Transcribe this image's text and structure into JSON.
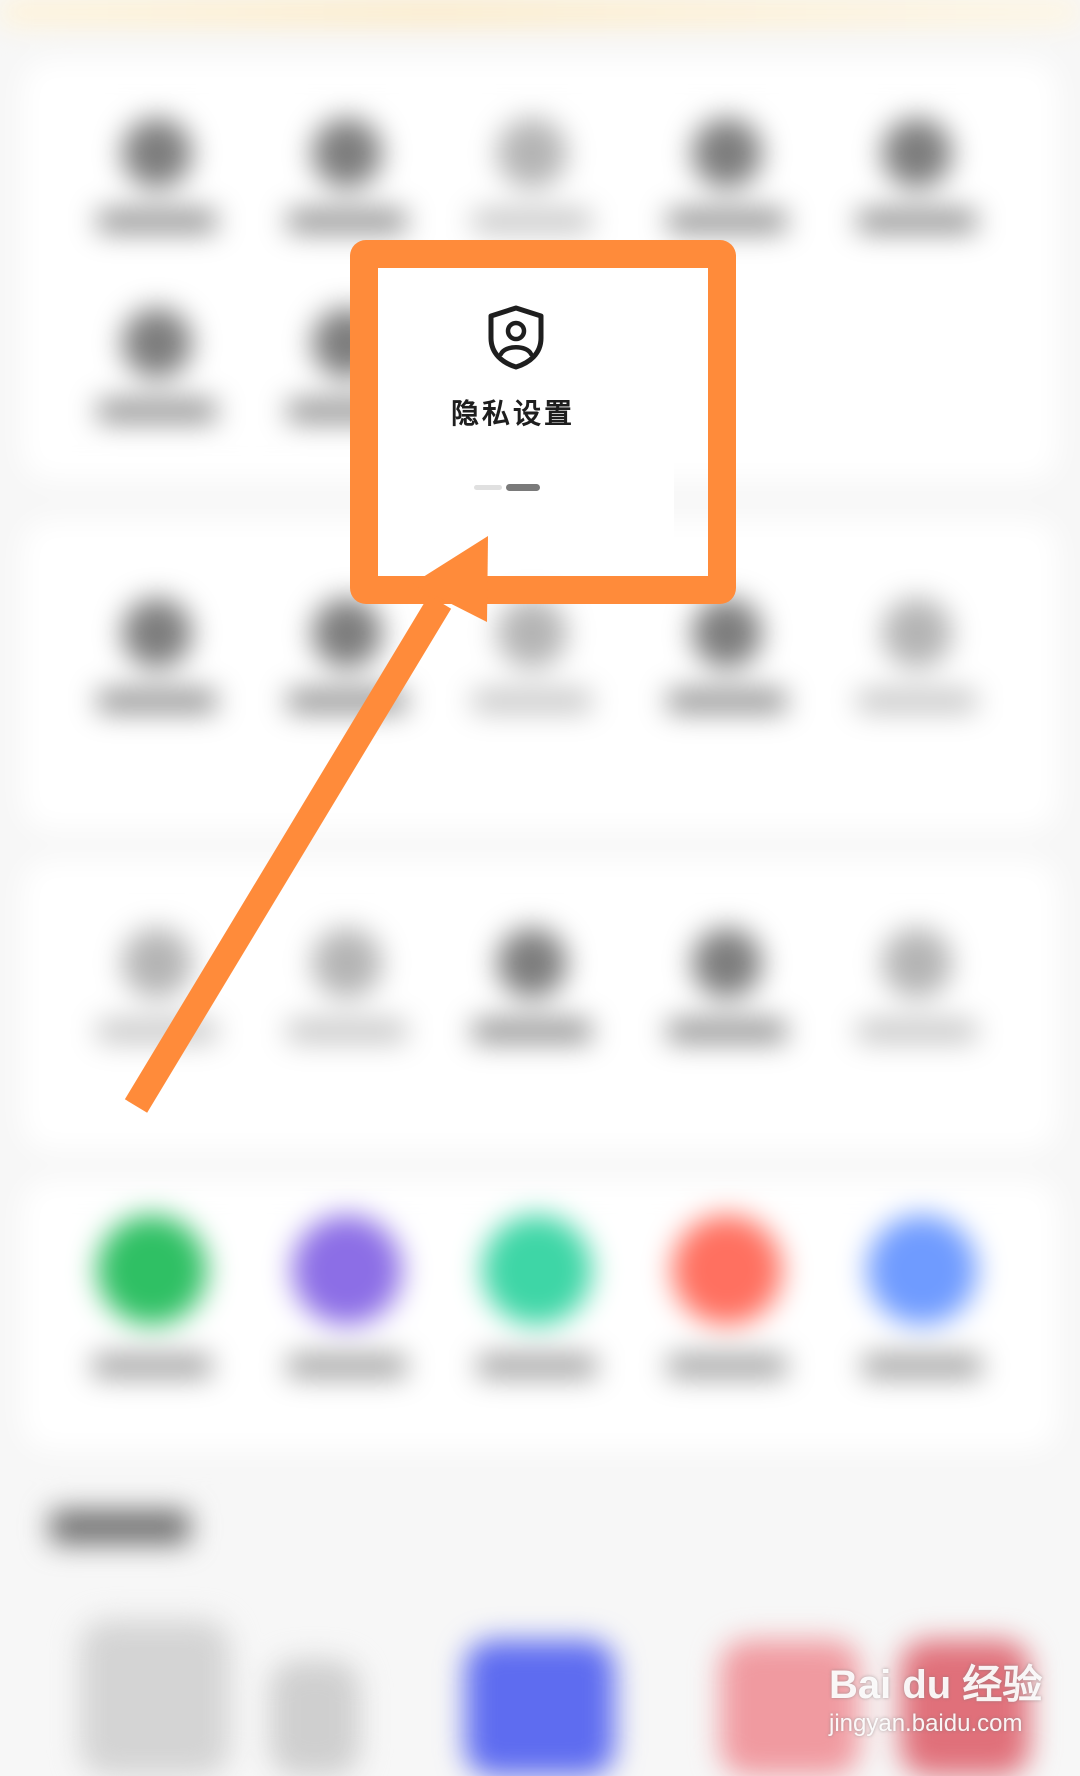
{
  "popup": {
    "icon": "shield-user-icon",
    "label": "隐私设置"
  },
  "colors": {
    "highlight": "#ff8b3a",
    "app_green": "#2fc064",
    "app_purple": "#8c6ee6",
    "app_teal": "#3ed6a6",
    "app_red": "#ff7060",
    "app_blue": "#6f9bff",
    "tile_blue": "#5e6cf0"
  },
  "watermark": {
    "brand": "Bai du 经验",
    "url": "jingyan.baidu.com"
  }
}
